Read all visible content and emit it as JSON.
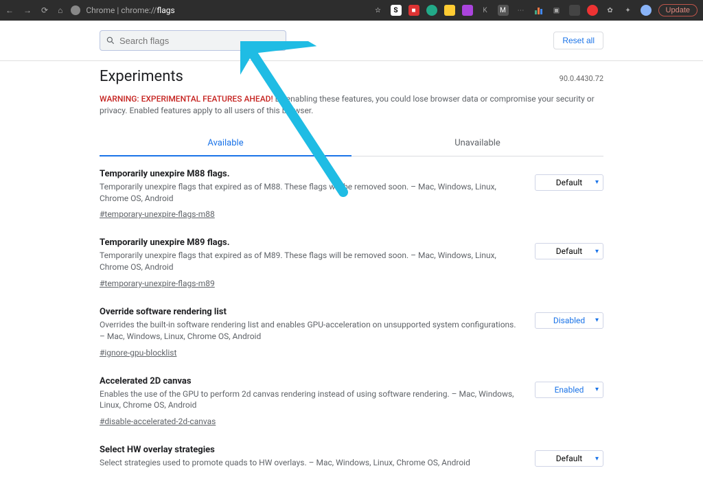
{
  "browser": {
    "address_prefix": "Chrome | ",
    "address_host": "chrome://",
    "address_page": "flags",
    "update_label": "Update"
  },
  "search": {
    "placeholder": "Search flags"
  },
  "header": {
    "reset_label": "Reset all",
    "title": "Experiments",
    "version": "90.0.4430.72",
    "warning_prefix": "WARNING: EXPERIMENTAL FEATURES AHEAD!",
    "warning_body": " By enabling these features, you could lose browser data or compromise your security or privacy. Enabled features apply to all users of this browser."
  },
  "tabs": {
    "available": "Available",
    "unavailable": "Unavailable"
  },
  "select_options": {
    "default": "Default",
    "enabled": "Enabled",
    "disabled": "Disabled"
  },
  "flags": [
    {
      "title": "Temporarily unexpire M88 flags.",
      "desc": "Temporarily unexpire flags that expired as of M88. These flags will be removed soon. – Mac, Windows, Linux, Chrome OS, Android",
      "link": "#temporary-unexpire-flags-m88",
      "value": "Default",
      "style": "default"
    },
    {
      "title": "Temporarily unexpire M89 flags.",
      "desc": "Temporarily unexpire flags that expired as of M89. These flags will be removed soon. – Mac, Windows, Linux, Chrome OS, Android",
      "link": "#temporary-unexpire-flags-m89",
      "value": "Default",
      "style": "default"
    },
    {
      "title": "Override software rendering list",
      "desc": "Overrides the built-in software rendering list and enables GPU-acceleration on unsupported system configurations. – Mac, Windows, Linux, Chrome OS, Android",
      "link": "#ignore-gpu-blocklist",
      "value": "Disabled",
      "style": "blue"
    },
    {
      "title": "Accelerated 2D canvas",
      "desc": "Enables the use of the GPU to perform 2d canvas rendering instead of using software rendering. – Mac, Windows, Linux, Chrome OS, Android",
      "link": "#disable-accelerated-2d-canvas",
      "value": "Enabled",
      "style": "blue"
    },
    {
      "title": "Select HW overlay strategies",
      "desc": "Select strategies used to promote quads to HW overlays. – Mac, Windows, Linux, Chrome OS, Android",
      "link": "",
      "value": "Default",
      "style": "default"
    }
  ]
}
